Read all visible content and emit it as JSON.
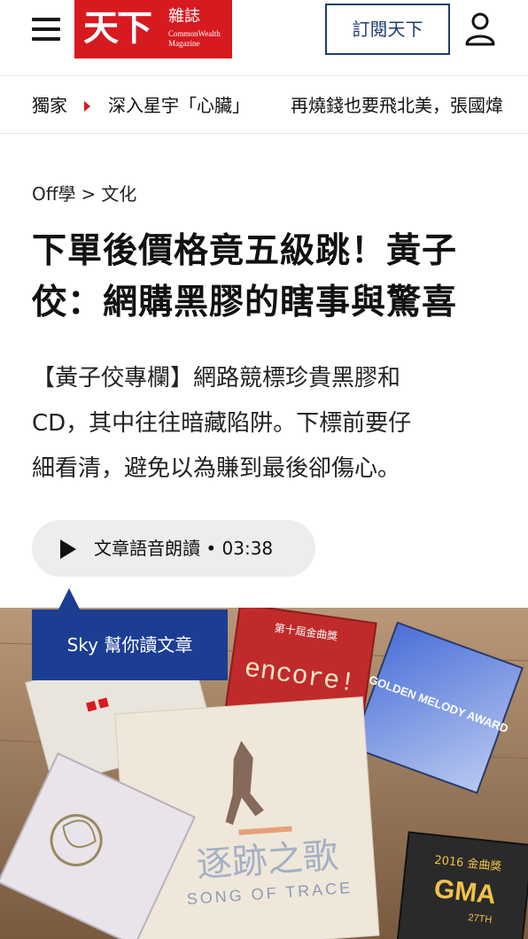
{
  "header": {
    "logo": {
      "big": "天下",
      "zh": "雜誌",
      "en_line1": "CommonWealth",
      "en_line2": "Magazine"
    },
    "subscribe_label": "訂閱天下",
    "menu_icon": "hamburger-menu-icon",
    "user_icon": "user-account-icon"
  },
  "ticker": {
    "label": "獨家",
    "items": [
      "深入星宇「心臟」",
      "再燒錢也要飛北美，張國煒"
    ]
  },
  "breadcrumb": {
    "section": "Off學",
    "separator": ">",
    "category": "文化"
  },
  "article": {
    "title_line1": "下單後價格竟五級跳！黃子",
    "title_line2": "佼：網購黑膠的瞎事與驚喜",
    "summary_line1": "【黃子佼專欄】網路競標珍貴黑膠和",
    "summary_line2": "CD，其中往往暗藏陷阱。下標前要仔",
    "summary_line3": "細看清，避免以為賺到最後卻傷心。"
  },
  "audio": {
    "label": "文章語音朗讀 • 03:38"
  },
  "tooltip": {
    "label": "Sky 幫你讀文章"
  },
  "photo": {
    "albums": {
      "encore": "encore!",
      "award_label": "第十屆金曲獎",
      "golden_melody": "GOLDEN MELODY AWARD",
      "song_title_zh": "逐跡之歌",
      "song_title_en": "SONG OF TRACE",
      "gma": "GMA",
      "gma_year": "2016 金曲獎",
      "gma_edition": "27TH"
    }
  },
  "colors": {
    "brand_red": "#d71920",
    "navy": "#1f3d6b",
    "tooltip_blue": "#1b3e93"
  }
}
